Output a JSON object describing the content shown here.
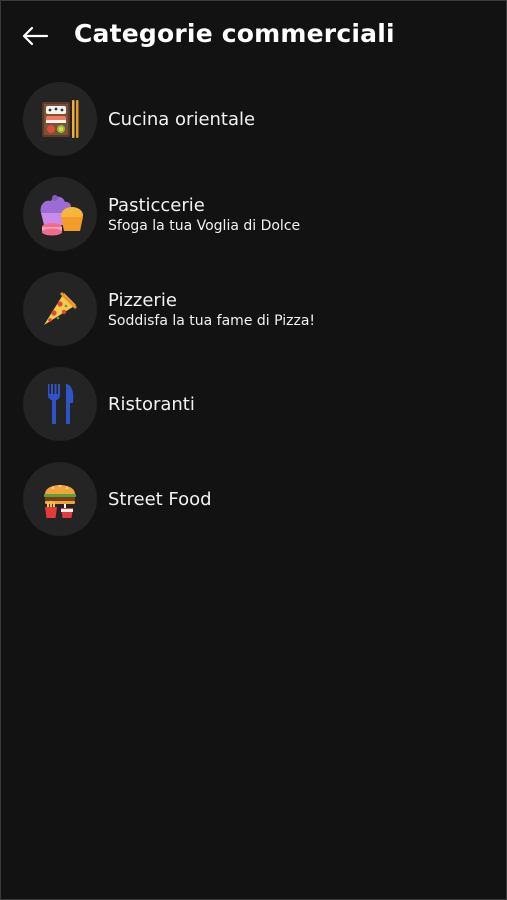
{
  "header": {
    "title": "Categorie commerciali",
    "back_icon": "arrow-left-icon"
  },
  "categories": [
    {
      "title": "Cucina orientale",
      "subtitle": "",
      "icon": "sushi-icon"
    },
    {
      "title": "Pasticcerie",
      "subtitle": "Sfoga la tua Voglia di Dolce",
      "icon": "cupcake-icon"
    },
    {
      "title": "Pizzerie",
      "subtitle": "Soddisfa la tua fame di Pizza!",
      "icon": "pizza-slice-icon"
    },
    {
      "title": "Ristoranti",
      "subtitle": "",
      "icon": "fork-knife-icon"
    },
    {
      "title": "Street Food",
      "subtitle": "",
      "icon": "burger-fries-icon"
    }
  ],
  "colors": {
    "background": "#121212",
    "avatar_background": "#242424",
    "text": "#ffffff"
  }
}
